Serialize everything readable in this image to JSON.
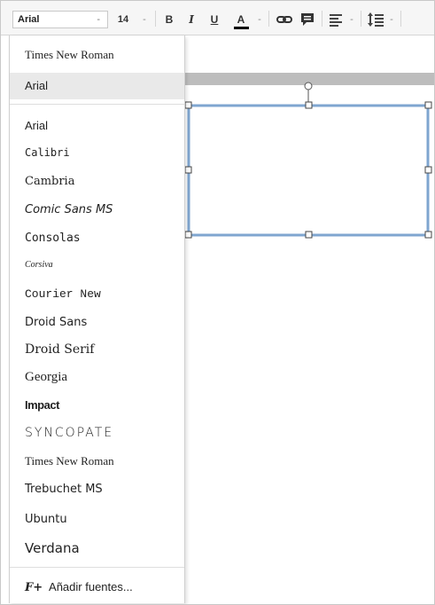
{
  "toolbar": {
    "font_name": "Arial",
    "font_dropdown": "-",
    "font_size": "14",
    "size_dropdown": "-",
    "bold": "B",
    "italic": "I",
    "underline": "U",
    "text_color": "A",
    "color_dropdown": "-",
    "align_dropdown": "-",
    "line_spacing_dropdown": "-",
    "text_color_bar": "#000000"
  },
  "menu": {
    "recent": [
      "Times New Roman",
      "Arial"
    ],
    "selected": "Arial",
    "fonts": [
      "Arial",
      "Calibri",
      "Cambria",
      "Comic Sans MS",
      "Consolas",
      "Corsiva",
      "Courier New",
      "Droid Sans",
      "Droid Serif",
      "Georgia",
      "Impact",
      "Syncopate",
      "Times New Roman",
      "Trebuchet MS",
      "Ubuntu",
      "Verdana"
    ],
    "add_fonts_icon": "F+",
    "add_fonts_label": "Añadir fuentes..."
  },
  "colors": {
    "selection_border": "#7fa6d0",
    "highlight": "#e9e9e9",
    "gray_bar": "#bdbdbd"
  }
}
